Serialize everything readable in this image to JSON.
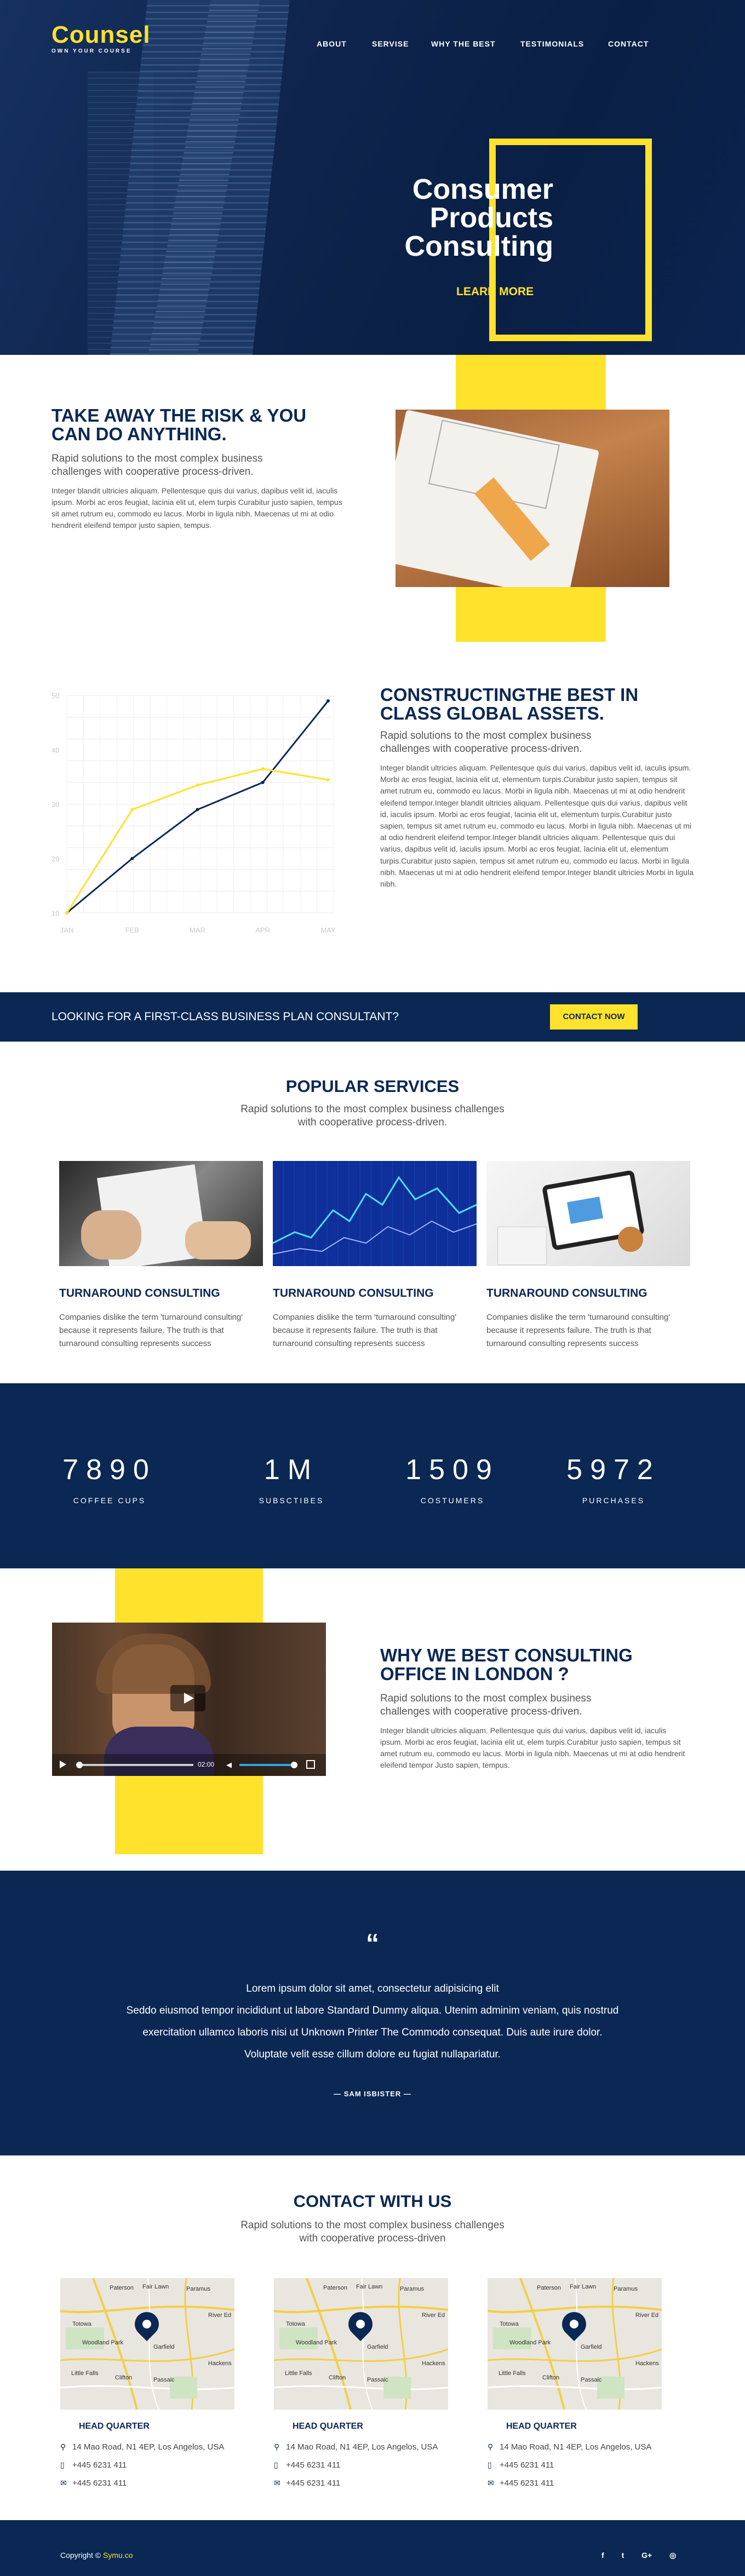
{
  "brand": {
    "name": "Counsel",
    "tagline": "OWN YOUR COURSE"
  },
  "nav": [
    "ABOUT",
    "SERVISE",
    "WHY THE BEST",
    "TESTIMONIALS",
    "CONTACT"
  ],
  "hero": {
    "line1": "Consumer",
    "line2": "Products",
    "line3": "Consulting",
    "cta": "LEARN MORE"
  },
  "risk": {
    "title_l1": "TAKE AWAY THE RISK & YOU",
    "title_l2": "CAN DO ANYTHING.",
    "sub_l1": "Rapid solutions to the most complex business",
    "sub_l2": "challenges with cooperative process-driven.",
    "body": "Integer blandit ultricies aliquam. Pellentesque quis dui varius, dapibus velit id, iaculis ipsum. Morbi ac eros feugiat, lacinia elit ut, elem turpis Curabitur justo sapien, tempus sit amet rutrum eu, commodo eu lacus. Morbi in ligula nibh. Maecenas ut mi at odio hendrerit eleifend tempor justo sapien, tempus."
  },
  "constructing": {
    "title_l1": "CONSTRUCTINGTHE BEST IN",
    "title_l2": "CLASS GLOBAL ASSETS.",
    "sub_l1": "Rapid solutions to the most complex business",
    "sub_l2": "challenges with cooperative process-driven.",
    "body": "Integer blandit ultricies aliquam. Pellentesque quis dui varius, dapibus velit id, iaculis ipsum. Morbi ac eros feugiat, lacinia elit ut, elementum turpis.Curabitur justo sapien, tempus sit amet rutrum eu, commodo eu lacus. Morbi in ligula nibh. Maecenas ut mi at odio hendrerit eleifend tempor.Integer blandit ultricies aliquam. Pellentesque quis dui varius, dapibus velit id, iaculis ipsum. Morbi ac eros feugiat, lacinia elit ut, elementum turpis.Curabitur justo sapien, tempus sit amet rutrum eu, commodo eu lacus. Morbi in ligula nibh. Maecenas ut mi at odio hendrerit eleifend tempor.Integer blandit ultricies aliquam. Pellentesque quis dui varius, dapibus velit id, iaculis ipsum. Morbi ac eros feugiat, lacinia elit ut, elementum turpis.Curabitur justo sapien, tempus sit amet rutrum eu, commodo eu lacus. Morbi in ligula nibh. Maecenas ut mi at odio hendrerit eleifend tempor.Integer blandit ultricies Morbi in ligula nibh."
  },
  "chart_data": {
    "type": "line",
    "categories": [
      "JAN",
      "FEB",
      "MAR",
      "APR",
      "MAY"
    ],
    "ylim": [
      10,
      50
    ],
    "yticks": [
      "50",
      "40",
      "30",
      "20",
      "10"
    ],
    "grid": true,
    "series": [
      {
        "color": "#0b2854",
        "values": [
          10,
          20,
          29,
          34,
          49
        ]
      },
      {
        "color": "#ffe22b",
        "values": [
          10,
          29,
          33.5,
          36.5,
          34.5
        ]
      }
    ]
  },
  "banner": {
    "text": "LOOKING FOR A FIRST-CLASS BUSINESS PLAN CONSULTANT?",
    "button": "CONTACT NOW"
  },
  "services": {
    "title": "POPULAR SERVICES",
    "sub_l1": "Rapid solutions to the most complex business challenges",
    "sub_l2": "with cooperative process-driven.",
    "items": [
      {
        "title": "TURNAROUND CONSULTING",
        "l1": "Companies dislike the term 'turnaround consulting'",
        "l2": "because it represents failure. The truth is that",
        "l3": "turnaround consulting represents success"
      },
      {
        "title": "TURNAROUND CONSULTING",
        "l1": "Companies dislike the term 'turnaround consulting'",
        "l2": "because it represents failure. The truth is that",
        "l3": "turnaround consulting represents success"
      },
      {
        "title": "TURNAROUND CONSULTING",
        "l1": "Companies dislike the term 'turnaround consulting'",
        "l2": "because it represents failure. The truth is that",
        "l3": "turnaround consulting represents success"
      }
    ]
  },
  "stats": [
    {
      "number": "7890",
      "label": "COFFEE CUPS"
    },
    {
      "number": "1M",
      "label": "SUBSCTIBES"
    },
    {
      "number": "1509",
      "label": "COSTUMERS"
    },
    {
      "number": "5972",
      "label": "PURCHASES"
    }
  ],
  "why": {
    "title_l1": "WHY WE BEST CONSULTING",
    "title_l2": "OFFICE IN LONDON ?",
    "sub_l1": "Rapid solutions to the most complex business",
    "sub_l2": "challenges with cooperative process-driven.",
    "body": "Integer blandit ultricies aliquam. Pellentesque quis dui varius, dapibus velit id, iaculis ipsum. Morbi ac eros feugiat, lacinia elit ut, elem turpis.Curabitur justo sapien, tempus sit amet rutrum eu, commodo eu lacus. Morbi in ligula nibh. Maecenas ut mi at odio hendrerit eleifend tempor Justo sapien, tempus.",
    "video_time": "02:00"
  },
  "testimonial": {
    "quote_mark": "“",
    "l1": "Lorem ipsum dolor sit amet, consectetur adipisicing elit",
    "l2": "Seddo eiusmod tempor incididunt ut labore Standard Dummy aliqua. Utenim adminim veniam, quis nostrud",
    "l3": "exercitation ullamco laboris nisi ut Unknown Printer The Commodo consequat. Duis aute irure dolor.",
    "l4": "Voluptate velit esse cillum dolore eu fugiat nullapariatur.",
    "author": "— SAM ISBISTER —"
  },
  "contact": {
    "title": "CONTACT WITH US",
    "sub_l1": "Rapid solutions to the most complex business challenges",
    "sub_l2": "with cooperative process-driven",
    "map_labels": [
      "Paterson",
      "Fair Lawn",
      "Paramus",
      "Totowa",
      "Woodland Park",
      "Garfield",
      "Little Falls",
      "Clifton",
      "Passaic",
      "Hackens",
      "River Ed"
    ],
    "cards": [
      {
        "heading": "HEAD QUARTER",
        "address": "14 Mao Road, N1 4EP, Los Angelos, USA",
        "phone": "+445 6231 411",
        "email": "+445 6231 411"
      },
      {
        "heading": "HEAD QUARTER",
        "address": "14 Mao Road, N1 4EP, Los Angelos, USA",
        "phone": "+445 6231 411",
        "email": "+445 6231 411"
      },
      {
        "heading": "HEAD QUARTER",
        "address": "14 Mao Road, N1 4EP, Los Angelos, USA",
        "phone": "+445 6231 411",
        "email": "+445 6231 411"
      }
    ]
  },
  "footer": {
    "copyright": "Copyright ©",
    "site": "Symu.co",
    "social": [
      "f",
      "t",
      "G+",
      "◎"
    ]
  }
}
